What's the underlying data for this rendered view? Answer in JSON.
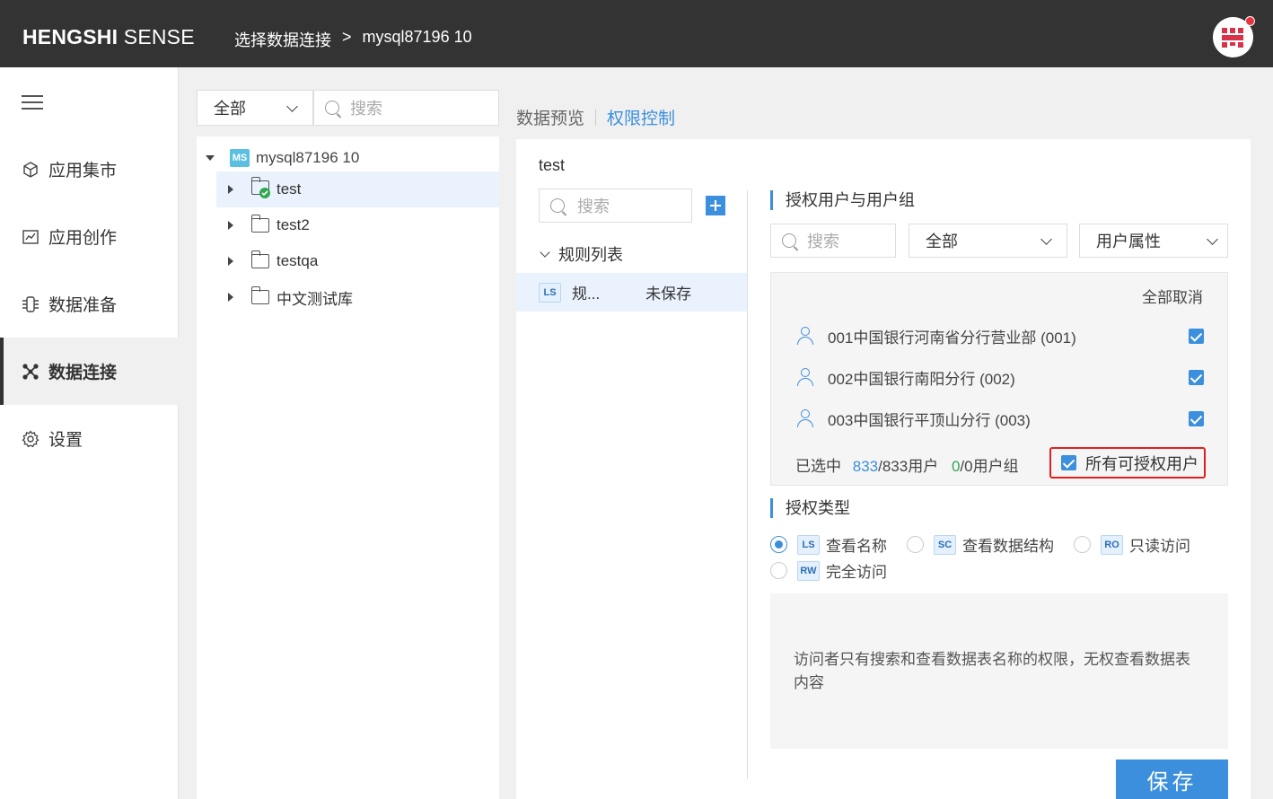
{
  "header": {
    "brand_bold": "HENGSHI",
    "brand_rest": " SENSE",
    "breadcrumb": [
      "选择数据连接",
      ">",
      "mysql87196 10"
    ]
  },
  "leftnav": {
    "items": [
      {
        "label": "应用集市",
        "icon": "cube-icon"
      },
      {
        "label": "应用创作",
        "icon": "chart-icon"
      },
      {
        "label": "数据准备",
        "icon": "data-prep-icon"
      },
      {
        "label": "数据连接",
        "icon": "connection-icon",
        "active": true
      },
      {
        "label": "设置",
        "icon": "gear-icon"
      }
    ]
  },
  "tree": {
    "filter_value": "全部",
    "search_placeholder": "搜索",
    "root": {
      "badge": "MS",
      "label": "mysql87196 10"
    },
    "nodes": [
      {
        "label": "test",
        "selected": true
      },
      {
        "label": "test2"
      },
      {
        "label": "testqa"
      },
      {
        "label": "中文测试库"
      }
    ]
  },
  "main": {
    "tabs": [
      "数据预览",
      "权限控制"
    ],
    "active_tab": "权限控制",
    "table_name": "test",
    "rules": {
      "search_placeholder": "搜索",
      "list_title": "规则列表",
      "items": [
        {
          "badge": "LS",
          "name": "规...",
          "status": "未保存"
        }
      ]
    },
    "auth": {
      "section_title": "授权用户与用户组",
      "search_placeholder": "搜索",
      "scope_value": "全部",
      "attr_value": "用户属性",
      "deselect_all": "全部取消",
      "users": [
        {
          "label": "001中国银行河南省分行营业部 (001)",
          "checked": true
        },
        {
          "label": "002中国银行南阳分行 (002)",
          "checked": true
        },
        {
          "label": "003中国银行平顶山分行 (003)",
          "checked": true
        }
      ],
      "summary_prefix": "已选中",
      "selected_users": "833",
      "users_suffix": "/833用户",
      "selected_groups": "0",
      "groups_suffix": "/0用户组",
      "all_users_label": "所有可授权用户"
    },
    "perm": {
      "section_title": "授权类型",
      "options": [
        {
          "badge": "LS",
          "label": "查看名称",
          "selected": true
        },
        {
          "badge": "SC",
          "label": "查看数据结构"
        },
        {
          "badge": "RO",
          "label": "只读访问"
        },
        {
          "badge": "RW",
          "label": "完全访问"
        }
      ],
      "description": "访问者只有搜索和查看数据表名称的权限，无权查看数据表内容"
    },
    "save_label": "保存"
  },
  "colors": {
    "topbar": "#333333",
    "accent": "#3b8fdc",
    "highlight": "#e02020",
    "green_count": "#2fa84f"
  }
}
